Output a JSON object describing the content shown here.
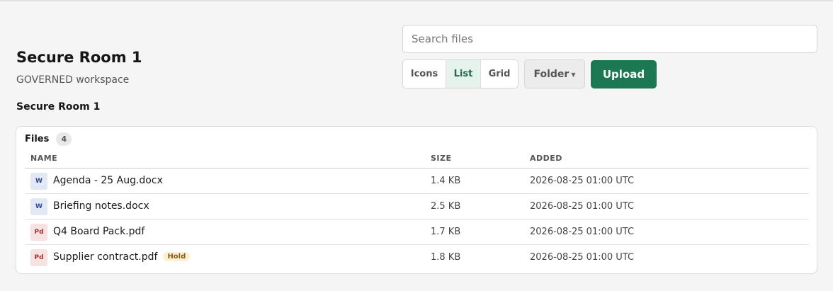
{
  "room": {
    "title": "Secure Room 1",
    "subtitle": "GOVERNED workspace",
    "breadcrumb": "Secure Room 1"
  },
  "search": {
    "placeholder": "Search files",
    "value": ""
  },
  "view_toggle": {
    "options": [
      "Icons",
      "List",
      "Grid"
    ],
    "selected": "List"
  },
  "folder_button": {
    "label": "Folder",
    "icon": "chevron-down-icon"
  },
  "upload_button": {
    "label": "Upload"
  },
  "colors": {
    "accent": "#1b7852",
    "selected_view_bg": "#e5f3ec",
    "hold_badge_bg": "#fbf0d6",
    "word_icon_bg": "#e3e9f4",
    "pdf_icon_bg": "#f7e2e2"
  },
  "files_panel": {
    "title": "Files",
    "count": "4",
    "columns": [
      "NAME",
      "SIZE",
      "ADDED"
    ],
    "rows": [
      {
        "icon": "W",
        "type": "word",
        "name": "Agenda - 25 Aug.docx",
        "badge": "",
        "size": "1.4 KB",
        "added": "2026-08-25 01:00 UTC"
      },
      {
        "icon": "W",
        "type": "word",
        "name": "Briefing notes.docx",
        "badge": "",
        "size": "2.5 KB",
        "added": "2026-08-25 01:00 UTC"
      },
      {
        "icon": "Pd",
        "type": "pdf",
        "name": "Q4 Board Pack.pdf",
        "badge": "",
        "size": "1.7 KB",
        "added": "2026-08-25 01:00 UTC"
      },
      {
        "icon": "Pd",
        "type": "pdf",
        "name": "Supplier contract.pdf",
        "badge": "Hold",
        "size": "1.8 KB",
        "added": "2026-08-25 01:00 UTC"
      }
    ]
  }
}
